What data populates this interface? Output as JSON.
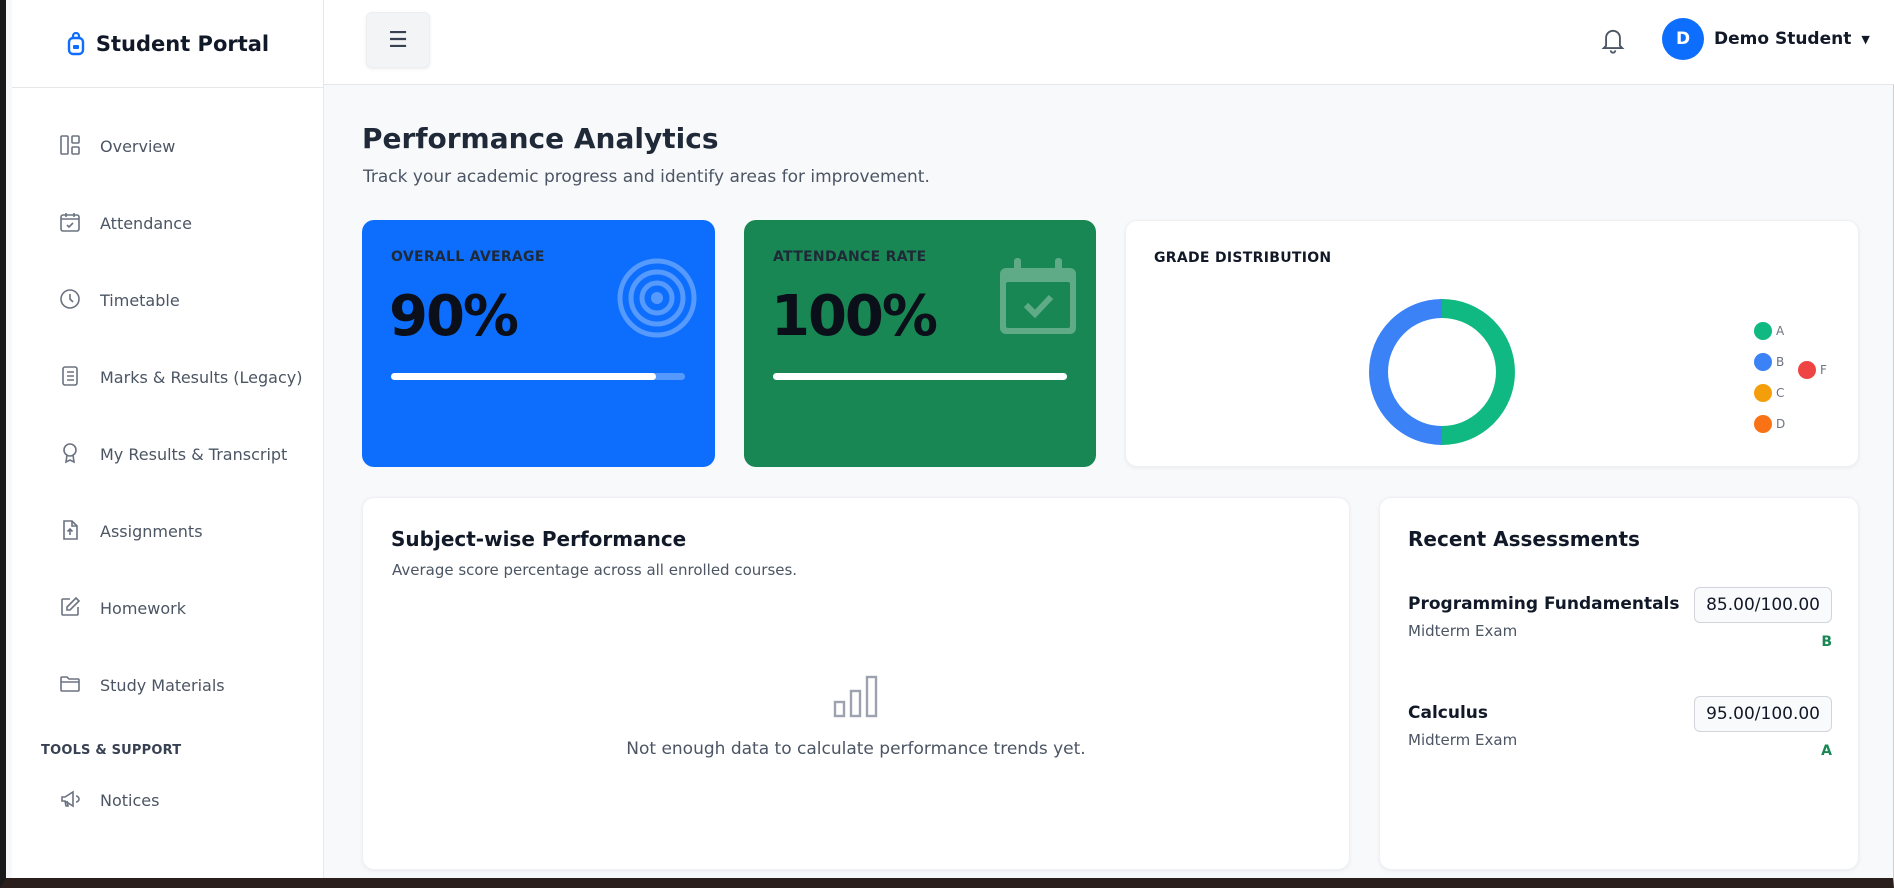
{
  "brand": {
    "title": "Student Portal"
  },
  "sidebar": {
    "items": [
      {
        "label": "Overview",
        "icon": "dashboard-icon"
      },
      {
        "label": "Attendance",
        "icon": "calendar-check-icon"
      },
      {
        "label": "Timetable",
        "icon": "clock-icon"
      },
      {
        "label": "Marks & Results (Legacy)",
        "icon": "document-list-icon"
      },
      {
        "label": "My Results & Transcript",
        "icon": "award-icon"
      },
      {
        "label": "Assignments",
        "icon": "file-upload-icon"
      },
      {
        "label": "Homework",
        "icon": "pencil-square-icon"
      },
      {
        "label": "Study Materials",
        "icon": "folder-icon"
      }
    ],
    "section_label": "TOOLS & SUPPORT",
    "tools": [
      {
        "label": "Notices",
        "icon": "megaphone-icon"
      }
    ]
  },
  "topbar": {
    "menu_glyph": "☰",
    "user": {
      "initial": "D",
      "name": "Demo Student"
    }
  },
  "page": {
    "title": "Performance Analytics",
    "subtitle": "Track your academic progress and identify areas for improvement."
  },
  "stats": {
    "average": {
      "label": "OVERALL AVERAGE",
      "value": "90%",
      "progress": 0.9,
      "color": "#0d6efd"
    },
    "attendance": {
      "label": "ATTENDANCE RATE",
      "value": "100%",
      "progress": 1.0,
      "color": "#198754"
    }
  },
  "grade_distribution": {
    "title": "GRADE DISTRIBUTION",
    "chart_data": {
      "type": "pie",
      "labels": [
        "A",
        "B",
        "C",
        "D",
        "F"
      ],
      "values": [
        1,
        1,
        0,
        0,
        0
      ],
      "colors": [
        "#10b981",
        "#3b82f6",
        "#f59e0b",
        "#f97316",
        "#ef4444"
      ]
    }
  },
  "subject_performance": {
    "title": "Subject-wise Performance",
    "description": "Average score percentage across all enrolled courses.",
    "empty_message": "Not enough data to calculate performance trends yet."
  },
  "recent": {
    "title": "Recent Assessments",
    "items": [
      {
        "name": "Programming Fundamentals",
        "type": "Midterm Exam",
        "score": "85.00/100.00",
        "grade": "B"
      },
      {
        "name": "Calculus",
        "type": "Midterm Exam",
        "score": "95.00/100.00",
        "grade": "A"
      }
    ]
  }
}
